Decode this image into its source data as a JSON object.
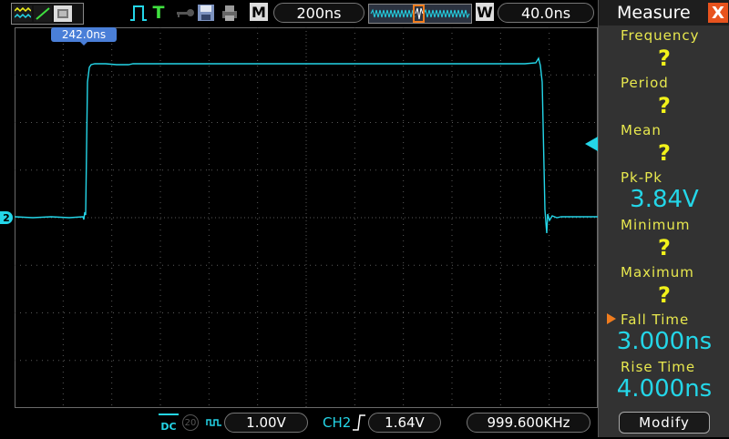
{
  "toolbar": {
    "mode_icons": [
      "wave-icon",
      "math-icon",
      "cursor-icon"
    ],
    "run_icon": "pulse-icon",
    "trigger_letter": "T",
    "m_label": "M",
    "timebase": "200ns",
    "w_label": "W",
    "window": "40.0ns"
  },
  "screen": {
    "cursor_readout": "242.0ns",
    "ch2_marker": "2",
    "trace_color": "#24d6e8"
  },
  "measure": {
    "title": "Measure",
    "close": "X",
    "items": [
      {
        "label": "Frequency",
        "value": "?"
      },
      {
        "label": "Period",
        "value": "?"
      },
      {
        "label": "Mean",
        "value": "?"
      },
      {
        "label": "Pk-Pk",
        "value": "3.84V"
      },
      {
        "label": "Minimum",
        "value": "?"
      },
      {
        "label": "Maximum",
        "value": "?"
      },
      {
        "label": "Fall Time",
        "value": "3.000ns"
      },
      {
        "label": "Rise Time",
        "value": "4.000ns"
      }
    ],
    "modify": "Modify"
  },
  "bottom": {
    "coupling": "DC",
    "bw_badge": "20",
    "vdiv": "1.00V",
    "trig_source": "CH2",
    "trig_level": "1.64V",
    "frequency": "999.600KHz"
  },
  "colors": {
    "accent_cyan": "#24d6e8",
    "label_yellow": "#e8e84e",
    "close_orange": "#e8531e"
  }
}
